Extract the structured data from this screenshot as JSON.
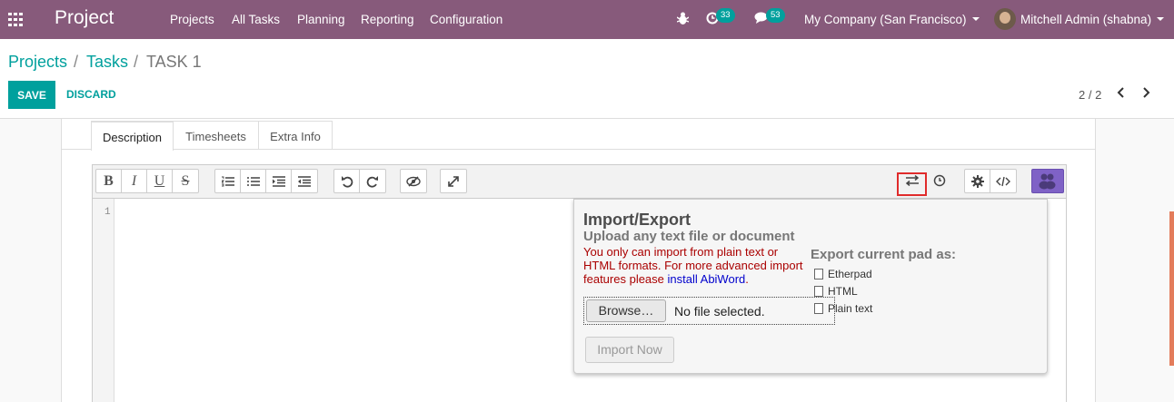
{
  "navbar": {
    "brand": "Project",
    "menu": [
      "Projects",
      "All Tasks",
      "Planning",
      "Reporting",
      "Configuration"
    ],
    "activity_count": "33",
    "message_count": "53",
    "company": "My Company (San Francisco)",
    "user": "Mitchell Admin (shabna)",
    "icons": [
      "apps-grid-icon",
      "bug-icon",
      "clock-icon",
      "chat-icon"
    ]
  },
  "breadcrumb": {
    "projects": "Projects",
    "tasks": "Tasks",
    "sep": "/",
    "current": "TASK 1"
  },
  "actions": {
    "save": "SAVE",
    "discard": "DISCARD"
  },
  "pager": {
    "text": "2 / 2"
  },
  "tabs": [
    "Description",
    "Timesheets",
    "Extra Info"
  ],
  "toolbar": {
    "format": [
      "B",
      "I",
      "U",
      "S"
    ]
  },
  "editor": {
    "line_number": "1"
  },
  "import_export": {
    "title": "Import/Export",
    "subtitle": "Upload any text file or document",
    "warning_prefix": "You only can import from plain text or HTML formats. For more advanced import features please ",
    "warning_link": "install AbiWord",
    "warning_suffix": ".",
    "browse": "Browse…",
    "no_file": "No file selected.",
    "import_now": "Import Now",
    "export_title": "Export current pad as:",
    "export_options": [
      "Etherpad",
      "HTML",
      "Plain text"
    ]
  },
  "colors": {
    "navbar": "#875a7b",
    "accent": "#00a09d",
    "highlight": "#e02b2b",
    "purple": "#7f62c6"
  }
}
